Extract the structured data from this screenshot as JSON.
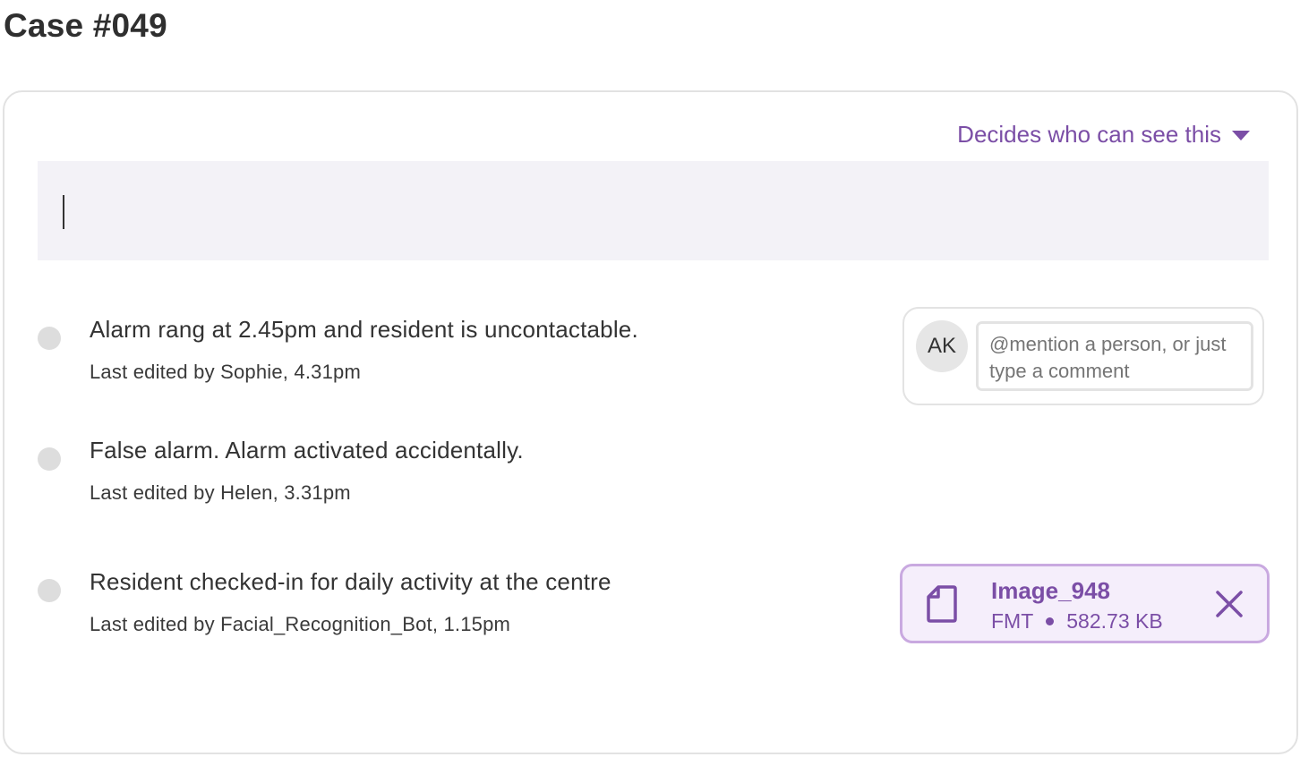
{
  "page": {
    "title": "Case #049"
  },
  "visibility": {
    "label": "Decides who can see this",
    "icon": "caret-down-icon"
  },
  "editor": {
    "value": ""
  },
  "entries": [
    {
      "text": "Alarm rang at 2.45pm and resident is uncontactable.",
      "meta": "Last edited by Sophie, 4.31pm"
    },
    {
      "text": "False alarm. Alarm activated accidentally.",
      "meta": "Last edited by Helen, 3.31pm"
    },
    {
      "text": "Resident checked-in for daily activity at the centre",
      "meta": "Last edited by Facial_Recognition_Bot, 1.15pm"
    }
  ],
  "comment": {
    "avatar_initials": "AK",
    "placeholder": "@mention a person, or just type a comment"
  },
  "attachment": {
    "name": "Image_948",
    "format": "FMT",
    "size": "582.73 KB",
    "icon": "file-icon",
    "remove_icon": "close-icon"
  },
  "colors": {
    "accent": "#7b4ea6",
    "attachment_bg": "#f5eefb",
    "attachment_border": "#c9a9e0",
    "editor_bg": "#f3f2f7",
    "dot": "#dddddd"
  }
}
